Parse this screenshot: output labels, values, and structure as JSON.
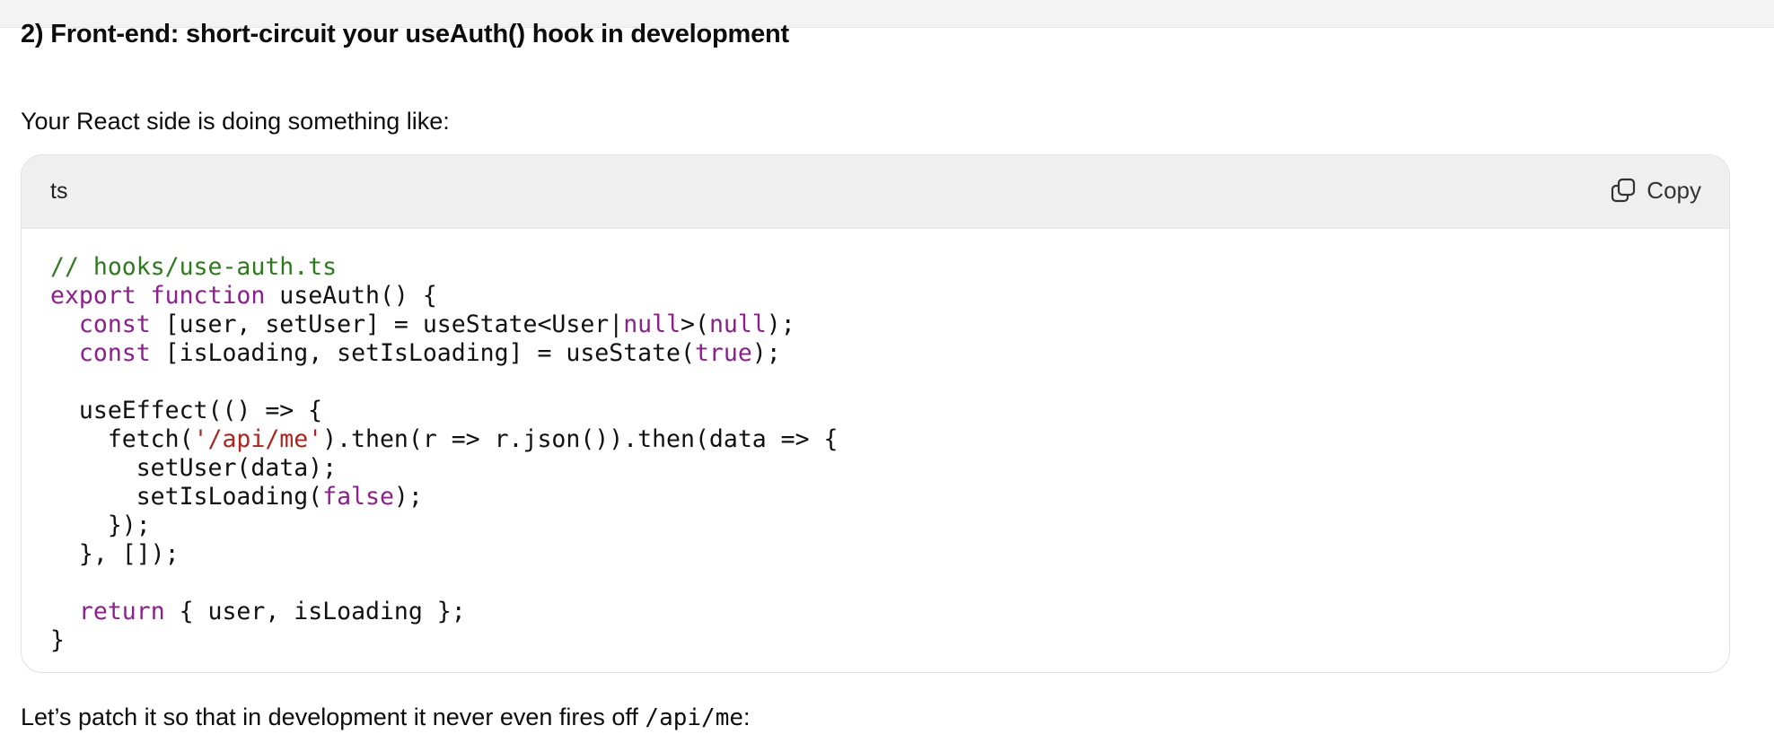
{
  "heading": "2) Front-end: short-circuit your useAuth() hook in development",
  "intro": "Your React side is doing something like:",
  "code_block": {
    "language": "ts",
    "copy_label": "Copy",
    "copy_icon": "copy-icon",
    "lines": [
      [
        {
          "t": "comment",
          "v": "// hooks/use-auth.ts"
        }
      ],
      [
        {
          "t": "keyword",
          "v": "export function"
        },
        {
          "t": "plain",
          "v": " useAuth() {"
        }
      ],
      [
        {
          "t": "plain",
          "v": "  "
        },
        {
          "t": "keyword",
          "v": "const"
        },
        {
          "t": "plain",
          "v": " [user, setUser] = useState<User|"
        },
        {
          "t": "keyword",
          "v": "null"
        },
        {
          "t": "plain",
          "v": ">("
        },
        {
          "t": "keyword",
          "v": "null"
        },
        {
          "t": "plain",
          "v": ");"
        }
      ],
      [
        {
          "t": "plain",
          "v": "  "
        },
        {
          "t": "keyword",
          "v": "const"
        },
        {
          "t": "plain",
          "v": " [isLoading, setIsLoading] = useState("
        },
        {
          "t": "keyword",
          "v": "true"
        },
        {
          "t": "plain",
          "v": ");"
        }
      ],
      [],
      [
        {
          "t": "plain",
          "v": "  useEffect(() => {"
        }
      ],
      [
        {
          "t": "plain",
          "v": "    fetch("
        },
        {
          "t": "string",
          "v": "'/api/me'"
        },
        {
          "t": "plain",
          "v": ").then(r => r.json()).then(data => {"
        }
      ],
      [
        {
          "t": "plain",
          "v": "      setUser(data);"
        }
      ],
      [
        {
          "t": "plain",
          "v": "      setIsLoading("
        },
        {
          "t": "keyword",
          "v": "false"
        },
        {
          "t": "plain",
          "v": ");"
        }
      ],
      [
        {
          "t": "plain",
          "v": "    });"
        }
      ],
      [
        {
          "t": "plain",
          "v": "  }, []);"
        }
      ],
      [],
      [
        {
          "t": "plain",
          "v": "  "
        },
        {
          "t": "keyword",
          "v": "return"
        },
        {
          "t": "plain",
          "v": " { user, isLoading };"
        }
      ],
      [
        {
          "t": "plain",
          "v": "}"
        }
      ]
    ]
  },
  "outro": {
    "text": "Let’s patch it so that in development it never even fires off ",
    "code": "/api/me",
    "suffix": ":"
  },
  "colors": {
    "comment": "#2d7a1c",
    "keyword": "#8c1f8c",
    "string": "#b0241b",
    "code_header_bg": "#efefef"
  }
}
